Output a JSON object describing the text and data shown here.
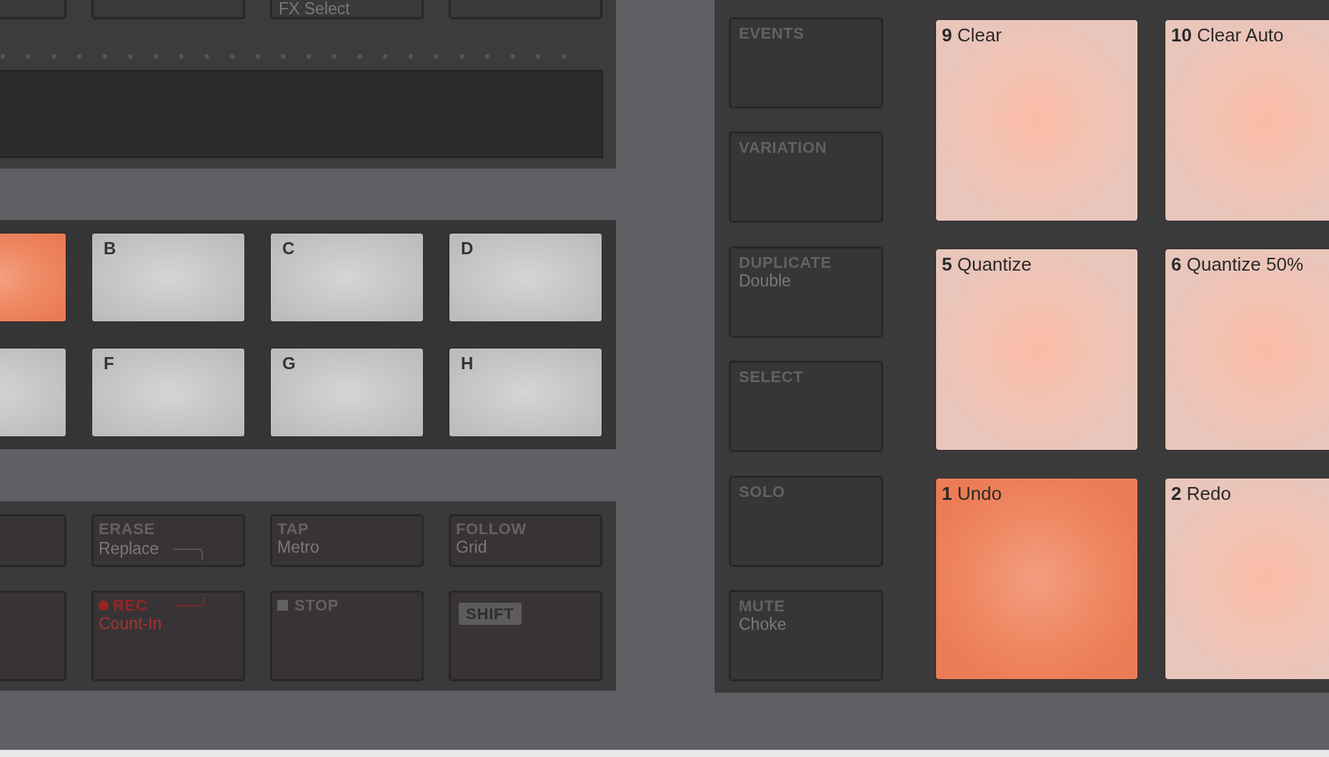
{
  "top_buttons": [
    {
      "kind": "blank"
    },
    {
      "kind": "blank"
    },
    {
      "kind": "plain",
      "sublabel": "FX Select"
    },
    {
      "kind": "blank"
    }
  ],
  "group_pads": [
    {
      "selected": true
    },
    {
      "label": "B",
      "selected": false
    },
    {
      "label": "C",
      "selected": false
    },
    {
      "label": "D",
      "selected": false
    },
    {
      "selected": false
    },
    {
      "label": "F",
      "selected": false
    },
    {
      "label": "G",
      "selected": false
    },
    {
      "label": "H",
      "selected": false
    }
  ],
  "transport_buttons": [
    {
      "kind": "blank"
    },
    {
      "kind": "plain",
      "label": "ERASE",
      "sublabel": "Replace",
      "bracket": true
    },
    {
      "kind": "plain",
      "label": "TAP",
      "sublabel": "Metro"
    },
    {
      "kind": "plain",
      "label": "FOLLOW",
      "sublabel": "Grid"
    },
    {
      "kind": "blank"
    },
    {
      "kind": "record",
      "label": "REC",
      "sublabel": "Count-In",
      "bracket": true
    },
    {
      "kind": "stop",
      "label": "STOP"
    },
    {
      "kind": "shift",
      "label": "SHIFT"
    }
  ],
  "mode_buttons": [
    {
      "kind": "plain",
      "label": "EVENTS"
    },
    {
      "kind": "plain",
      "label": "VARIATION"
    },
    {
      "kind": "plain",
      "label": "DUPLICATE",
      "sublabel": "Double"
    },
    {
      "kind": "plain",
      "label": "SELECT"
    },
    {
      "kind": "plain",
      "label": "SOLO"
    },
    {
      "kind": "plain",
      "label": "MUTE",
      "sublabel": "Choke"
    }
  ],
  "pads": [
    {
      "label": "**9** Clear",
      "selected": false
    },
    {
      "label": "**10** Clear Auto",
      "selected": false
    },
    {
      "label": "**5** Quantize",
      "selected": false
    },
    {
      "label": "**6** Quantize 50%",
      "selected": false
    },
    {
      "label": "**1** Undo",
      "selected": true
    },
    {
      "label": "**2** Redo",
      "selected": false
    }
  ]
}
